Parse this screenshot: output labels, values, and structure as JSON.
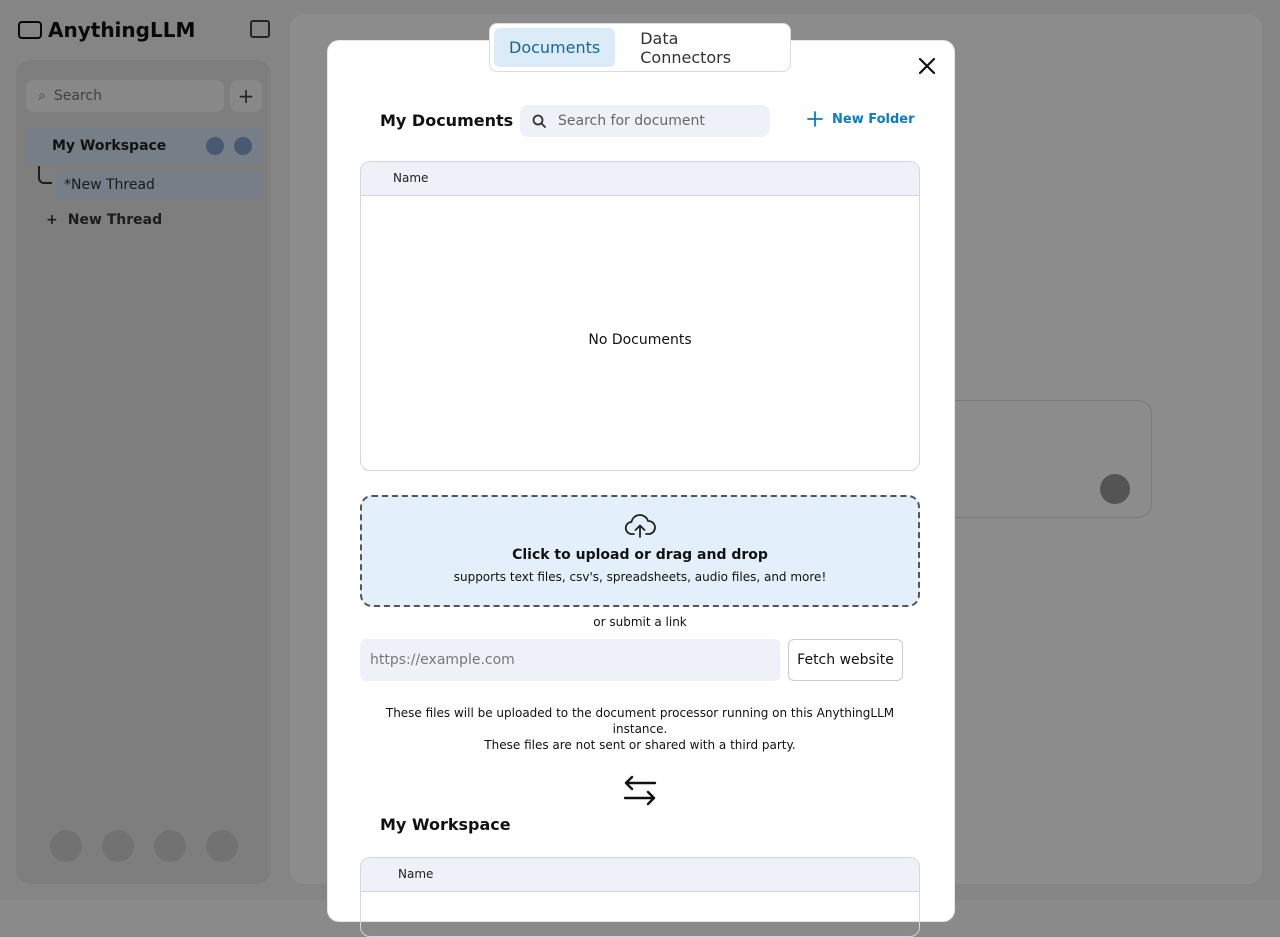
{
  "app": {
    "name": "AnythingLLM",
    "sidebar": {
      "search_placeholder": "Search",
      "workspace_name": "My Workspace",
      "active_thread": "*New Thread",
      "new_thread_label": "New Thread"
    }
  },
  "modal": {
    "tabs": [
      {
        "label": "Documents",
        "active": true
      },
      {
        "label": "Data Connectors",
        "active": false
      }
    ],
    "my_documents": {
      "title": "My Documents",
      "search_placeholder": "Search for document",
      "new_folder_label": "New Folder",
      "column_name": "Name",
      "empty_message": "No Documents"
    },
    "upload": {
      "title": "Click to upload or drag and drop",
      "subtitle": "supports text files, csv's, spreadsheets, audio files, and more!",
      "or_link": "or submit a link",
      "url_placeholder": "https://example.com",
      "fetch_button": "Fetch website",
      "privacy_line1": "These files will be uploaded to the document processor running on this AnythingLLM instance.",
      "privacy_line2": "These files are not sent or shared with a third party."
    },
    "workspace": {
      "title": "My Workspace",
      "column_name": "Name"
    }
  },
  "colors": {
    "accent": "#0b7bc4",
    "tab_active_bg": "#dcebf8",
    "dropzone_bg": "#e3f0fb",
    "table_header_bg": "#eef1f8"
  }
}
